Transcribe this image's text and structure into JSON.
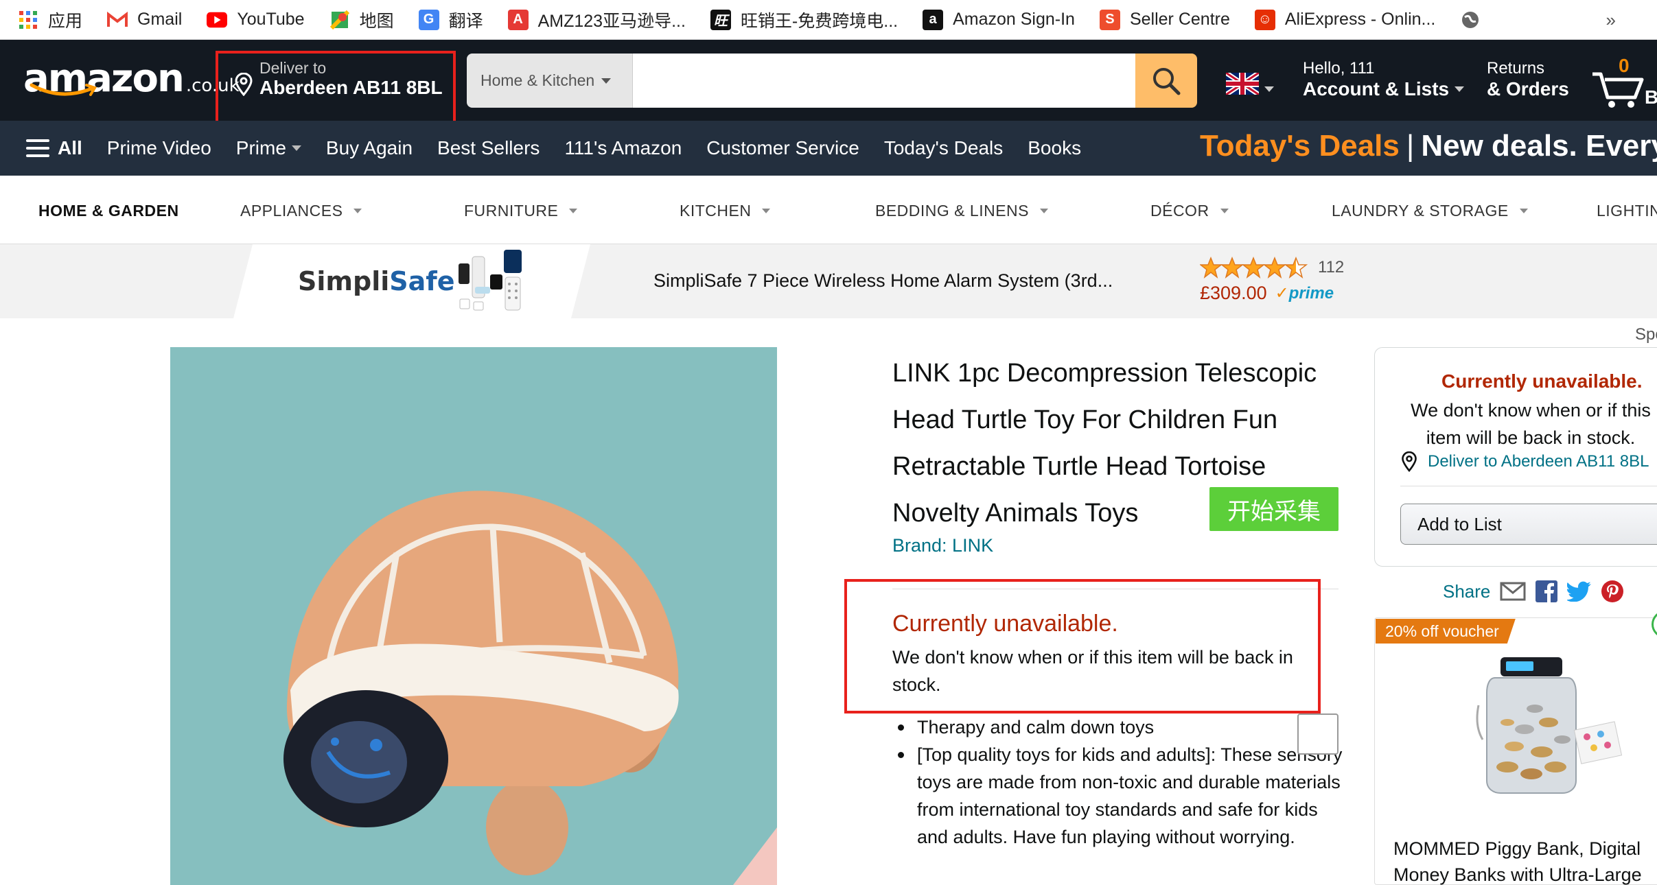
{
  "bookmarks": [
    {
      "label": "应用",
      "icon": "apps-grid-icon"
    },
    {
      "label": "Gmail",
      "icon": "gmail-icon"
    },
    {
      "label": "YouTube",
      "icon": "youtube-icon"
    },
    {
      "label": "地图",
      "icon": "maps-icon"
    },
    {
      "label": "翻译",
      "icon": "translate-icon"
    },
    {
      "label": "AMZ123亚马逊导...",
      "icon": "amz123-icon"
    },
    {
      "label": "旺销王-免费跨境电...",
      "icon": "wangxiaowang-icon"
    },
    {
      "label": "Amazon Sign-In",
      "icon": "amazon-icon"
    },
    {
      "label": "Seller Centre",
      "icon": "shopee-icon"
    },
    {
      "label": "AliExpress - Onlin...",
      "icon": "aliexpress-icon"
    }
  ],
  "bookmarks_more": "»",
  "header": {
    "logo_text": "amazon",
    "logo_tld": ".co.uk",
    "deliver_label": "Deliver to",
    "deliver_location": "Aberdeen AB11 8BL",
    "search_category": "Home & Kitchen",
    "search_placeholder": "",
    "account_greeting": "Hello, 111",
    "account_label": "Account & Lists",
    "returns_label": "Returns",
    "orders_label": "& Orders",
    "cart_count": "0",
    "cart_label": "B"
  },
  "nav": {
    "all_label": "All",
    "links": [
      "Prime Video",
      "Prime",
      "Buy Again",
      "Best Sellers",
      "111's Amazon",
      "Customer Service",
      "Today's Deals",
      "Books"
    ],
    "banner_orange": "Today's Deals",
    "banner_sep": "|",
    "banner_white": "New deals. Every"
  },
  "subnav": {
    "home": "HOME & GARDEN",
    "items": [
      "APPLIANCES",
      "FURNITURE",
      "KITCHEN",
      "BEDDING & LINENS",
      "DÉCOR",
      "LAUNDRY & STORAGE",
      "LIGHTIN"
    ]
  },
  "ad": {
    "brand_a": "Simpli",
    "brand_b": "Safe",
    "title": "SimpliSafe 7 Piece Wireless Home Alarm System (3rd...",
    "rating": 4.5,
    "review_count": "112",
    "price": "£309.00",
    "prime_label": "prime"
  },
  "product": {
    "title": "LINK 1pc Decompression Telescopic Head Turtle Toy For Children Fun Retractable Turtle Head Tortoise Novelty Animals Toys",
    "brand": "Brand: LINK",
    "collect_button": "开始采集",
    "unavailable_title": "Currently unavailable.",
    "unavailable_text": "We don't know when or if this item will be back in stock.",
    "bullets": [
      "Therapy and calm down toys",
      "[Top quality toys for kids and adults]: These sensory toys are made from non-toxic and durable materials from international toy standards and safe for kids and adults. Have fun playing without worrying."
    ]
  },
  "buybox": {
    "sponsored_hint": "Spo",
    "title": "Currently unavailable.",
    "text": "We don't know when or if this item will be back in stock.",
    "deliver": "Deliver to Aberdeen AB11 8BL",
    "add_to_list": "Add to List",
    "share_label": "Share"
  },
  "sponsored": {
    "voucher": "20% off voucher",
    "title": "MOMMED Piggy Bank, Digital Money Banks with Ultra-Large"
  },
  "colors": {
    "amazon_dark": "#131921",
    "amazon_nav": "#232f3e",
    "search_button": "#febd69",
    "unavailable_red": "#b12704",
    "link_teal": "#007185",
    "collect_green": "#5ccf3a",
    "annotation_red": "#e8211c"
  }
}
